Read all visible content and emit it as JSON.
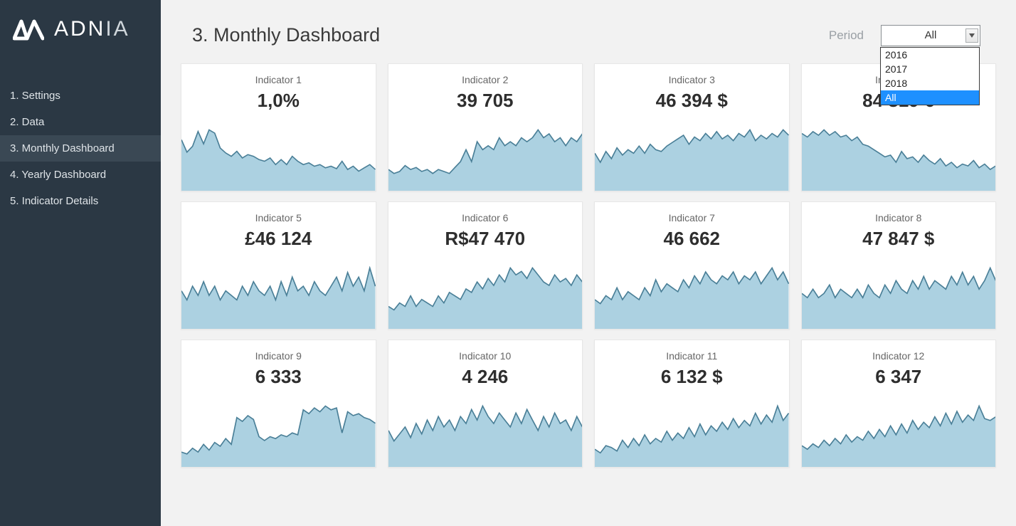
{
  "brand": {
    "name_strong": "ADN",
    "name_thin": "IA"
  },
  "sidebar": {
    "items": [
      {
        "label": "1. Settings"
      },
      {
        "label": "2. Data"
      },
      {
        "label": "3. Monthly Dashboard"
      },
      {
        "label": "4. Yearly Dashboard"
      },
      {
        "label": "5. Indicator Details"
      }
    ],
    "active_index": 2
  },
  "header": {
    "title": "3. Monthly Dashboard",
    "period_label": "Period",
    "period_value": "All",
    "period_options": [
      "2016",
      "2017",
      "2018",
      "All"
    ],
    "period_selected_index": 3
  },
  "indicators": [
    {
      "title": "Indicator 1",
      "value": "1,0%"
    },
    {
      "title": "Indicator 2",
      "value": "39 705"
    },
    {
      "title": "Indicator 3",
      "value": "46 394 $"
    },
    {
      "title": "Indicator 4",
      "value": "84 819 €"
    },
    {
      "title": "Indicator 5",
      "value": "£46 124"
    },
    {
      "title": "Indicator 6",
      "value": "R$47 470"
    },
    {
      "title": "Indicator 7",
      "value": "46 662"
    },
    {
      "title": "Indicator 8",
      "value": "47 847 $"
    },
    {
      "title": "Indicator 9",
      "value": "6 333"
    },
    {
      "title": "Indicator 10",
      "value": "4 246"
    },
    {
      "title": "Indicator 11",
      "value": "6 132 $"
    },
    {
      "title": "Indicator 12",
      "value": "6 347"
    }
  ],
  "chart_data": [
    {
      "type": "area",
      "title": "Indicator 1",
      "values": [
        60,
        45,
        52,
        70,
        55,
        72,
        68,
        50,
        44,
        40,
        46,
        38,
        42,
        40,
        36,
        34,
        38,
        30,
        36,
        30,
        40,
        34,
        30,
        32,
        28,
        30,
        26,
        28,
        25,
        34,
        24,
        28,
        22,
        26,
        30,
        24
      ]
    },
    {
      "type": "area",
      "title": "Indicator 2",
      "values": [
        10,
        8,
        9,
        12,
        10,
        11,
        9,
        10,
        8,
        10,
        9,
        8,
        11,
        14,
        20,
        14,
        24,
        20,
        22,
        20,
        26,
        22,
        24,
        22,
        26,
        24,
        26,
        30,
        26,
        28,
        24,
        26,
        22,
        26,
        24,
        28
      ]
    },
    {
      "type": "area",
      "title": "Indicator 3",
      "values": [
        40,
        30,
        42,
        34,
        46,
        38,
        44,
        40,
        48,
        40,
        50,
        44,
        42,
        48,
        52,
        56,
        60,
        50,
        58,
        54,
        62,
        56,
        64,
        56,
        60,
        54,
        62,
        58,
        66,
        54,
        60,
        56,
        62,
        58,
        66,
        60
      ]
    },
    {
      "type": "area",
      "title": "Indicator 4",
      "values": [
        62,
        58,
        64,
        60,
        66,
        60,
        64,
        58,
        60,
        54,
        58,
        50,
        48,
        44,
        40,
        36,
        38,
        30,
        42,
        34,
        36,
        30,
        38,
        32,
        28,
        34,
        26,
        30,
        24,
        28,
        26,
        32,
        24,
        28,
        22,
        26
      ]
    },
    {
      "type": "area",
      "title": "Indicator 5",
      "values": [
        16,
        12,
        18,
        14,
        20,
        14,
        18,
        12,
        16,
        14,
        12,
        18,
        14,
        20,
        16,
        14,
        18,
        12,
        20,
        14,
        22,
        16,
        18,
        14,
        20,
        16,
        14,
        18,
        22,
        16,
        24,
        18,
        22,
        16,
        26,
        18
      ]
    },
    {
      "type": "area",
      "title": "Indicator 6",
      "values": [
        12,
        10,
        14,
        12,
        18,
        12,
        16,
        14,
        12,
        18,
        14,
        20,
        18,
        16,
        22,
        20,
        26,
        22,
        28,
        24,
        30,
        26,
        34,
        30,
        32,
        28,
        34,
        30,
        26,
        24,
        30,
        26,
        28,
        24,
        30,
        26
      ]
    },
    {
      "type": "area",
      "title": "Indicator 7",
      "values": [
        14,
        12,
        16,
        14,
        20,
        14,
        18,
        16,
        14,
        20,
        16,
        24,
        18,
        22,
        20,
        18,
        24,
        20,
        26,
        22,
        28,
        24,
        22,
        26,
        24,
        28,
        22,
        26,
        24,
        28,
        22,
        26,
        30,
        24,
        28,
        22
      ]
    },
    {
      "type": "area",
      "title": "Indicator 8",
      "values": [
        16,
        14,
        18,
        14,
        16,
        20,
        14,
        18,
        16,
        14,
        18,
        14,
        20,
        16,
        14,
        20,
        16,
        22,
        18,
        16,
        22,
        18,
        24,
        18,
        22,
        20,
        18,
        24,
        20,
        26,
        20,
        24,
        18,
        22,
        28,
        22
      ]
    },
    {
      "type": "area",
      "title": "Indicator 9",
      "values": [
        14,
        12,
        18,
        14,
        22,
        16,
        24,
        20,
        28,
        22,
        50,
        46,
        52,
        48,
        30,
        26,
        30,
        28,
        32,
        30,
        34,
        32,
        58,
        54,
        60,
        56,
        62,
        58,
        60,
        34,
        56,
        52,
        54,
        50,
        48,
        44
      ]
    },
    {
      "type": "area",
      "title": "Indicator 10",
      "values": [
        20,
        14,
        18,
        22,
        16,
        24,
        18,
        26,
        20,
        28,
        22,
        26,
        20,
        28,
        24,
        32,
        26,
        34,
        28,
        24,
        30,
        26,
        22,
        30,
        24,
        32,
        26,
        20,
        28,
        22,
        30,
        24,
        26,
        20,
        28,
        22
      ]
    },
    {
      "type": "area",
      "title": "Indicator 11",
      "values": [
        18,
        14,
        22,
        20,
        16,
        28,
        20,
        30,
        22,
        34,
        24,
        30,
        26,
        38,
        28,
        36,
        30,
        42,
        32,
        46,
        34,
        44,
        38,
        48,
        40,
        52,
        42,
        50,
        44,
        58,
        46,
        56,
        48,
        66,
        50,
        58
      ]
    },
    {
      "type": "area",
      "title": "Indicator 12",
      "values": [
        22,
        18,
        24,
        20,
        28,
        22,
        30,
        24,
        34,
        26,
        32,
        28,
        38,
        30,
        40,
        32,
        44,
        34,
        46,
        36,
        50,
        40,
        48,
        42,
        54,
        44,
        58,
        46,
        60,
        48,
        56,
        50,
        66,
        52,
        50,
        54
      ]
    }
  ],
  "colors": {
    "area_fill": "#a8cfdf",
    "area_stroke": "#4a7f97",
    "sidebar_bg": "#2b3844",
    "accent": "#1e90ff"
  }
}
